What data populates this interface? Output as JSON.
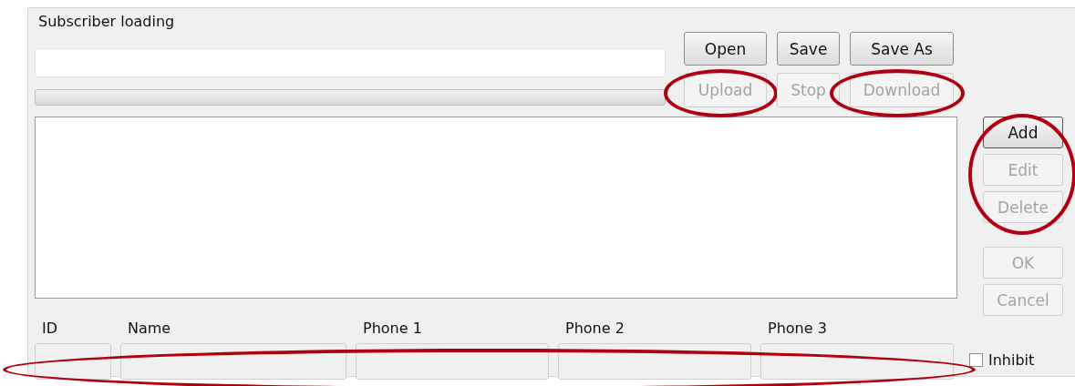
{
  "group": {
    "title": "Subscriber loading"
  },
  "progress": {
    "level": 0
  },
  "file_buttons": [
    {
      "label": "Open",
      "disabled": false,
      "circled": false
    },
    {
      "label": "Save",
      "disabled": false,
      "circled": false
    },
    {
      "label": "Save As",
      "disabled": false,
      "circled": false
    },
    {
      "label": "Upload",
      "disabled": true,
      "circled": true
    },
    {
      "label": "Stop",
      "disabled": true,
      "circled": false
    },
    {
      "label": "Download",
      "disabled": true,
      "circled": true
    }
  ],
  "edit_buttons": {
    "circled": true,
    "items": [
      {
        "label": "Add",
        "disabled": false,
        "default": true
      },
      {
        "label": "Edit",
        "disabled": true,
        "default": false
      },
      {
        "label": "Delete",
        "disabled": true,
        "default": false
      }
    ]
  },
  "confirm_buttons": [
    {
      "label": "OK",
      "disabled": true
    },
    {
      "label": "Cancel",
      "disabled": true
    }
  ],
  "fields": {
    "circled": true,
    "items": [
      {
        "label": "ID"
      },
      {
        "label": "Name"
      },
      {
        "label": "Phone 1"
      },
      {
        "label": "Phone 2"
      },
      {
        "label": "Phone 3"
      }
    ]
  },
  "inhibit": {
    "label": "Inhibit",
    "checked": false
  }
}
